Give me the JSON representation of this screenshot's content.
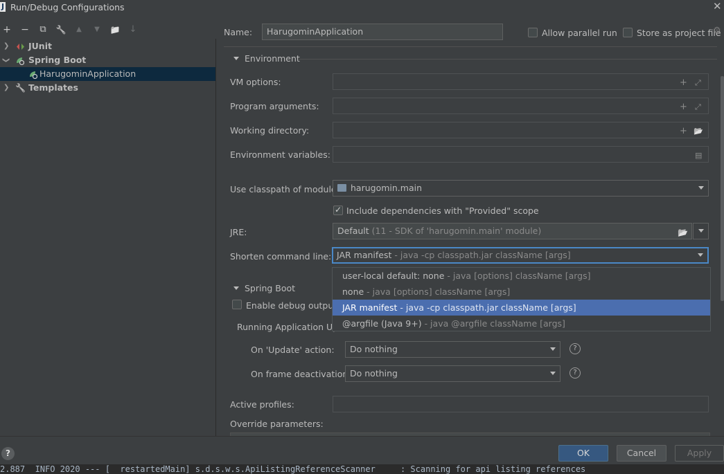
{
  "window": {
    "title": "Run/Debug Configurations",
    "app_icon_letter": "J"
  },
  "toolbar": {
    "add": "+",
    "remove": "−",
    "copy": "⧉",
    "edit": "🔧",
    "up": "▲",
    "down": "▼",
    "folder": "📁",
    "sort": "↓"
  },
  "tree": {
    "items": [
      {
        "label": "JUnit",
        "bold": true
      },
      {
        "label": "Spring Boot",
        "bold": true
      },
      {
        "label": "HarugominApplication",
        "bold": false
      },
      {
        "label": "Templates",
        "bold": true
      }
    ]
  },
  "header": {
    "name_label": "Name:",
    "name_value": "HarugominApplication",
    "allow_parallel": "Allow parallel run",
    "store_as_file": "Store as project file"
  },
  "environment": {
    "section_title": "Environment",
    "vm_options_label": "VM options:",
    "program_args_label": "Program arguments:",
    "working_dir_label": "Working directory:",
    "env_vars_label": "Environment variables:",
    "classpath_label": "Use classpath of module:",
    "classpath_value": "harugomin.main",
    "include_deps": "Include dependencies with \"Provided\" scope",
    "jre_label": "JRE:",
    "jre_value": "Default",
    "jre_hint": "(11 - SDK of 'harugomin.main' module)",
    "shorten_label": "Shorten command line:",
    "shorten_value": "JAR manifest",
    "shorten_hint": "- java -cp classpath.jar className [args]"
  },
  "shorten_options": [
    {
      "main": "user-local default: none",
      "hint": "- java [options] className [args]"
    },
    {
      "main": "none",
      "hint": "- java [options] className [args]"
    },
    {
      "main": "JAR manifest",
      "hint": "- java -cp classpath.jar className [args]"
    },
    {
      "main": "@argfile (Java 9+)",
      "hint": "- java @argfile className [args]"
    }
  ],
  "spring_boot": {
    "section_title": "Spring Boot",
    "enable_debug": "Enable debug output",
    "running_app_update": "Running Application Upd",
    "on_update_label": "On 'Update' action:",
    "on_update_value": "Do nothing",
    "on_frame_label": "On frame deactivation:",
    "on_frame_value": "Do nothing",
    "active_profiles_label": "Active profiles:",
    "override_params_label": "Override parameters:"
  },
  "buttons": {
    "help": "?",
    "ok": "OK",
    "cancel": "Cancel",
    "apply": "Apply"
  },
  "console_strip": "2.887  INFO 2020 --- [  restartedMain] s.d.s.w.s.ApiListingReferenceScanner     : Scanning for api listing references",
  "colors": {
    "background": "#3c3f41",
    "selection": "#4b6eaf",
    "focus_border": "#4a88c7",
    "primary_button": "#365880"
  }
}
